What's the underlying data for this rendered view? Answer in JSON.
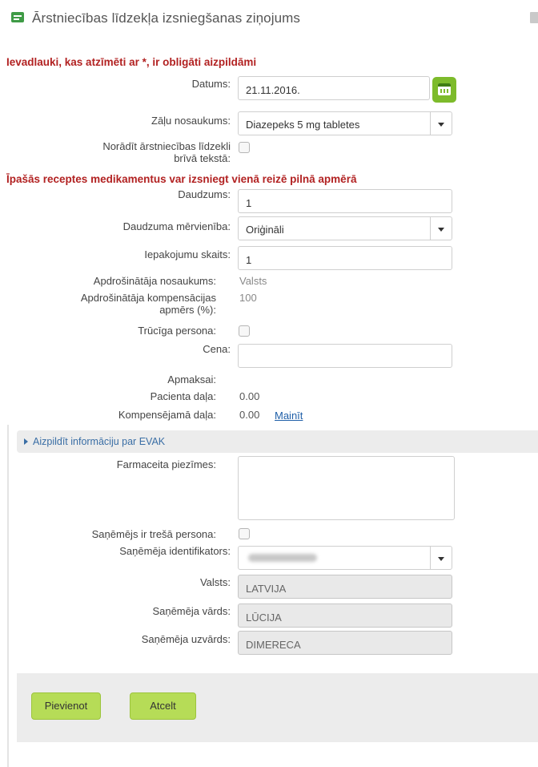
{
  "window": {
    "title": "Ārstniecības līdzekļa izsniegšanas ziņojums",
    "icon": "form-icon"
  },
  "required_note": "Ievadlauki, kas atzīmēti ar *, ir obligāti aizpildāmi",
  "special_note": "Īpašās receptes medikamentus var izsniegt vienā reizē pilnā apmērā",
  "fields": {
    "date": {
      "label": "Datums:",
      "value": "21.11.2016."
    },
    "drug_name": {
      "label": "Zāļu nosaukums:",
      "value": "Diazepeks 5 mg tabletes"
    },
    "free_text": {
      "label_line1": "Norādīt ārstniecības līdzekli",
      "label_line2": "brīvā tekstā:"
    },
    "quantity": {
      "label": "Daudzums:",
      "value": "1"
    },
    "unit": {
      "label": "Daudzuma mērvienība:",
      "value": "Oriģināli"
    },
    "packages": {
      "label": "Iepakojumu skaits:",
      "value": "1"
    },
    "insurer_name": {
      "label": "Apdrošinātāja nosaukums:",
      "value": "Valsts"
    },
    "insurer_comp": {
      "label_line1": "Apdrošinātāja kompensācijas",
      "label_line2": "apmērs (%):",
      "value": "100"
    },
    "poor_person": {
      "label": "Trūcīga persona:"
    },
    "price": {
      "label": "Cena:",
      "value": ""
    },
    "payment": {
      "label": "Apmaksai:"
    },
    "patient_share": {
      "label": "Pacienta daļa:",
      "value": "0.00"
    },
    "compensated_share": {
      "label": "Kompensējamā daļa:",
      "value": "0.00",
      "link": "Mainīt"
    },
    "pharmacist_notes": {
      "label": "Farmaceita piezīmes:",
      "value": ""
    },
    "third_party": {
      "label": "Saņēmējs ir trešā persona:"
    },
    "recipient_id": {
      "label": "Saņēmēja identifikators:"
    },
    "country": {
      "label": "Valsts:",
      "value": "LATVIJA"
    },
    "recipient_first": {
      "label": "Saņēmēja vārds:",
      "value": "LŪCIJA"
    },
    "recipient_last": {
      "label": "Saņēmēja uzvārds:",
      "value": "DIMERECA"
    }
  },
  "evak_toggle": "Aizpildīt informāciju par EVAK",
  "buttons": {
    "add": "Pievienot",
    "cancel": "Atcelt"
  },
  "colors": {
    "required": "#b22222",
    "button": "#b6dc57",
    "calendar": "#7dbb2b",
    "link": "#1f5fa8"
  }
}
